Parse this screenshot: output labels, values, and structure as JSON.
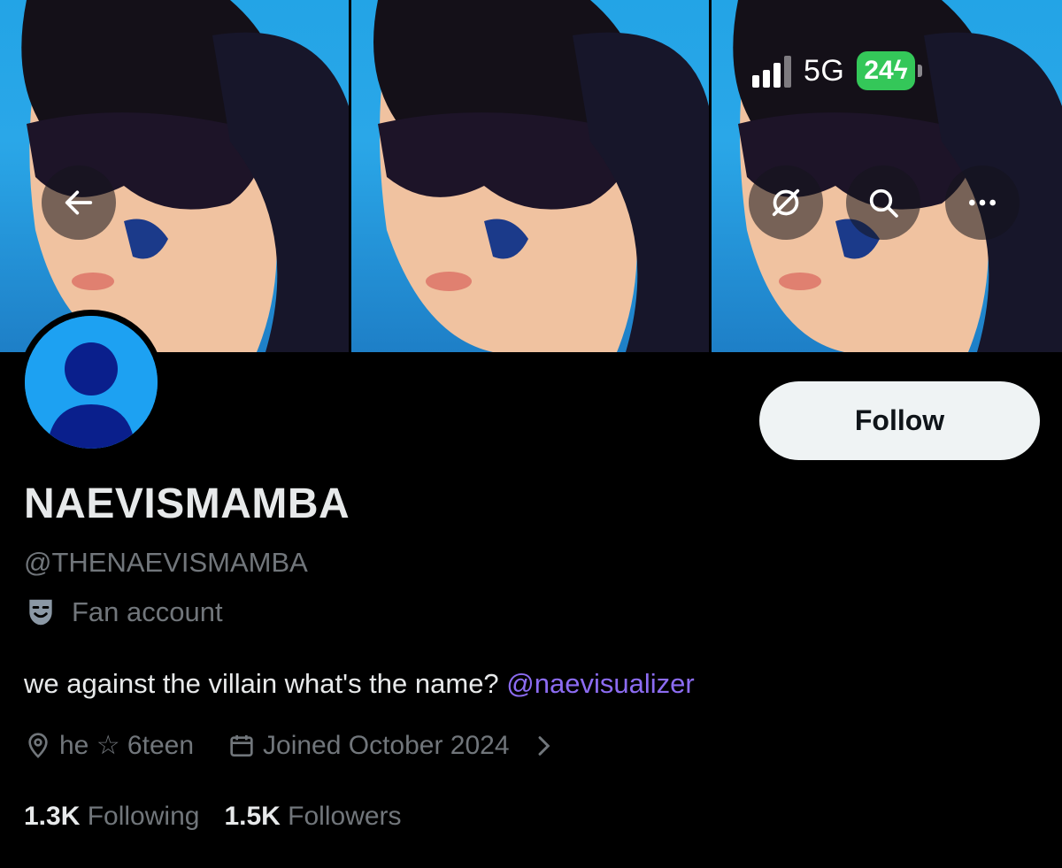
{
  "status_bar": {
    "network": "5G",
    "battery": "24"
  },
  "profile": {
    "display_name": "NAEVISMAMBA",
    "handle": "@THENAEVISMAMBA",
    "category": "Fan account",
    "bio_text": "we against the villain what's the name? ",
    "bio_mention": "@naevisualizer",
    "location": "he ☆ 6teen",
    "joined": "Joined October 2024",
    "following_count": "1.3K",
    "following_label": "Following",
    "followers_count": "1.5K",
    "followers_label": "Followers"
  },
  "actions": {
    "follow_label": "Follow"
  },
  "icons": {
    "back": "arrow-left-icon",
    "translate": "grok-icon",
    "search": "search-icon",
    "more": "more-icon",
    "location": "location-pin-icon",
    "calendar": "calendar-icon",
    "category": "theater-mask-icon",
    "chevron": "chevron-right-icon"
  },
  "colors": {
    "background": "#000000",
    "follow_bg": "#eff3f4",
    "mention": "#8c6cf2",
    "secondary_text": "#71767b",
    "battery_green": "#34c759",
    "avatar_bg": "#1da1f2"
  }
}
